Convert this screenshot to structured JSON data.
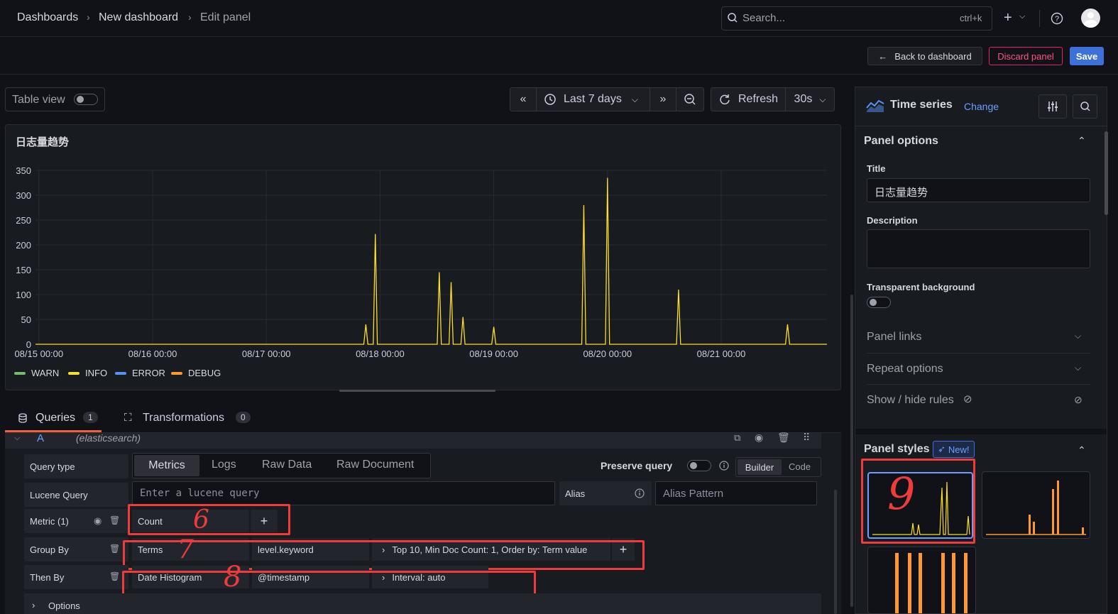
{
  "breadcrumb": {
    "item1": "Dashboards",
    "item2": "New dashboard",
    "item3": "Edit panel",
    "sep": "›"
  },
  "search": {
    "placeholder": "Search...",
    "shortcut": "ctrl+k"
  },
  "toolbar": {
    "back_label": "Back to dashboard",
    "discard_label": "Discard panel",
    "save_label": "Save"
  },
  "view": {
    "table_view_label": "Table view"
  },
  "time": {
    "range_label": "Last 7 days",
    "refresh_label": "Refresh",
    "interval_label": "30s"
  },
  "panel": {
    "title": "日志量趋势"
  },
  "chart_data": {
    "type": "line",
    "title": "日志量趋势",
    "yticks": [
      "350",
      "300",
      "250",
      "200",
      "150",
      "100",
      "50",
      "0"
    ],
    "xticks": [
      "08/15 00:00",
      "08/16 00:00",
      "08/17 00:00",
      "08/18 00:00",
      "08/19 00:00",
      "08/20 00:00",
      "08/21 00:00"
    ],
    "ylim": [
      0,
      350
    ],
    "grid": true,
    "legend_position": "bottom-left",
    "series": [
      {
        "name": "WARN",
        "color": "#73bf69",
        "values": []
      },
      {
        "name": "INFO",
        "color": "#fade2a",
        "x": [
          "08/15 00:00",
          "08/18 00:00",
          "08/18 12:00",
          "08/19 00:00",
          "08/19 12:00",
          "08/20 00:00",
          "08/21 00:00",
          "08/21 12:00"
        ],
        "peaks": [
          {
            "x": "08/17 21:00",
            "y": 40
          },
          {
            "x": "08/17 23:00",
            "y": 222
          },
          {
            "x": "08/18 12:30",
            "y": 145
          },
          {
            "x": "08/18 15:00",
            "y": 125
          },
          {
            "x": "08/18 17:30",
            "y": 55
          },
          {
            "x": "08/19 00:00",
            "y": 35
          },
          {
            "x": "08/19 19:00",
            "y": 280
          },
          {
            "x": "08/20 00:00",
            "y": 335
          },
          {
            "x": "08/20 15:00",
            "y": 110
          },
          {
            "x": "08/21 14:00",
            "y": 40
          }
        ]
      },
      {
        "name": "ERROR",
        "color": "#5794f2",
        "values": []
      },
      {
        "name": "DEBUG",
        "color": "#ff9830",
        "values": []
      }
    ]
  },
  "tabs": {
    "queries_label": "Queries",
    "queries_count": "1",
    "transformations_label": "Transformations",
    "transformations_count": "0"
  },
  "query": {
    "ref_id": "A",
    "datasource": "(elasticsearch)",
    "query_type_label": "Query type",
    "types": [
      "Metrics",
      "Logs",
      "Raw Data",
      "Raw Document"
    ],
    "preserve_label": "Preserve query",
    "builder_label": "Builder",
    "code_label": "Code",
    "lucene_label": "Lucene Query",
    "lucene_placeholder": "Enter a lucene query",
    "alias_label": "Alias",
    "alias_placeholder": "Alias Pattern",
    "metric_label": "Metric (1)",
    "metric_value": "Count",
    "groupby_label": "Group By",
    "groupby_type": "Terms",
    "groupby_field": "level.keyword",
    "groupby_options": "Top 10, Min Doc Count: 1, Order by: Term value",
    "thenby_label": "Then By",
    "thenby_type": "Date Histogram",
    "thenby_field": "@timestamp",
    "thenby_options": "Interval: auto",
    "options_label": "Options",
    "annot_6": "6",
    "annot_7": "7",
    "annot_8": "8",
    "annot_9": "9"
  },
  "sidebar": {
    "viz_name": "Time series",
    "change_label": "Change",
    "panel_options": "Panel options",
    "title_label": "Title",
    "title_value": "日志量趋势",
    "description_label": "Description",
    "transparent_label": "Transparent background",
    "panel_links": "Panel links",
    "repeat_options": "Repeat options",
    "show_hide": "Show / hide rules",
    "panel_styles": "Panel styles",
    "new_badge": "New!"
  }
}
